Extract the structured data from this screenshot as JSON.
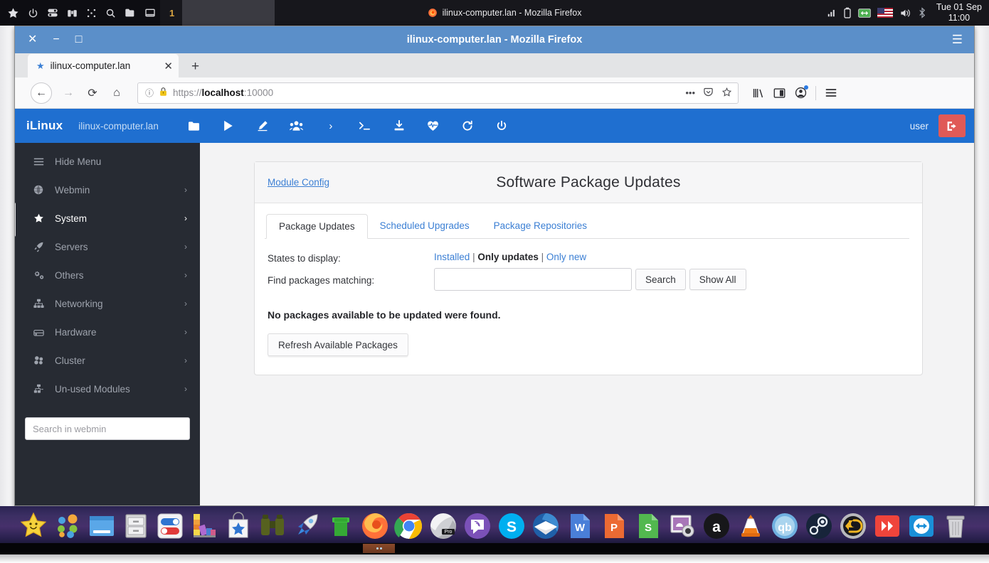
{
  "system_panel": {
    "left_icons": [
      {
        "name": "star-icon",
        "glyph": "★"
      },
      {
        "name": "power-icon",
        "glyph": "⏻"
      },
      {
        "name": "toggles-icon",
        "glyph": "⚏"
      },
      {
        "name": "binoculars-icon",
        "glyph": "🔭"
      },
      {
        "name": "grid-dots-icon",
        "glyph": "⠿"
      },
      {
        "name": "search-icon",
        "glyph": "🔍"
      },
      {
        "name": "folder-icon",
        "glyph": "📁"
      },
      {
        "name": "window-icon",
        "glyph": "🗖"
      }
    ],
    "desktop_number": "1",
    "window_title": "ilinux-computer.lan - Mozilla Firefox",
    "tray_icons": [
      "signal-icon",
      "battery-icon",
      "network-icon",
      "flag-us-icon",
      "volume-icon",
      "bluetooth-icon"
    ],
    "clock_date": "Tue 01 Sep",
    "clock_time": "11:00"
  },
  "browser": {
    "title": "ilinux-computer.lan - Mozilla Firefox",
    "window_buttons": {
      "close": "✕",
      "minimize": "−",
      "maximize": "□"
    },
    "hamburger": "☰",
    "tab": {
      "label": "ilinux-computer.lan",
      "close": "✕"
    },
    "new_tab": "+",
    "nav": {
      "back": "←",
      "forward": "→",
      "reload": "⟳",
      "home": "⌂"
    },
    "url": {
      "scheme": "https://",
      "host": "localhost",
      "port": ":10000",
      "full": "https://localhost:10000"
    },
    "url_actions": {
      "ellipsis": "•••",
      "pocket": "pocket-icon",
      "bookmark": "star-icon"
    },
    "toolbar_icons": [
      "library-icon",
      "sidebar-icon",
      "account-icon",
      "menu-icon"
    ]
  },
  "webmin": {
    "brand": "iLinux",
    "hostname": "ilinux-computer.lan",
    "nav_icons": [
      {
        "name": "folder-icon"
      },
      {
        "name": "play-icon"
      },
      {
        "name": "pencil-icon"
      },
      {
        "name": "users-icon"
      },
      {
        "name": "chevron-right-icon"
      },
      {
        "name": "terminal-icon"
      },
      {
        "name": "download-icon"
      },
      {
        "name": "heartbeat-icon"
      },
      {
        "name": "refresh-icon"
      },
      {
        "name": "power-icon"
      }
    ],
    "user": "user",
    "logout_label": "logout-icon",
    "sidebar": {
      "hide_menu": "Hide Menu",
      "items": [
        {
          "label": "Webmin",
          "icon": "globe-icon",
          "active": false
        },
        {
          "label": "System",
          "icon": "star-icon",
          "active": true
        },
        {
          "label": "Servers",
          "icon": "rocket-icon",
          "active": false
        },
        {
          "label": "Others",
          "icon": "gears-icon",
          "active": false
        },
        {
          "label": "Networking",
          "icon": "sitemap-icon",
          "active": false
        },
        {
          "label": "Hardware",
          "icon": "drive-icon",
          "active": false
        },
        {
          "label": "Cluster",
          "icon": "cubes-icon",
          "active": false
        },
        {
          "label": "Un-used Modules",
          "icon": "plug-icon",
          "active": false
        }
      ],
      "chevron": "›",
      "search_placeholder": "Search in webmin"
    },
    "panel": {
      "module_config": "Module Config",
      "title": "Software Package Updates",
      "tabs": [
        {
          "label": "Package Updates",
          "active": true
        },
        {
          "label": "Scheduled Upgrades",
          "active": false
        },
        {
          "label": "Package Repositories",
          "active": false
        }
      ],
      "states_label": "States to display:",
      "states": {
        "installed": "Installed",
        "sep1": "|",
        "only_updates": "Only updates",
        "sep2": "|",
        "only_new": "Only new"
      },
      "find_label": "Find packages matching:",
      "find_value": "",
      "find_placeholder": "",
      "search_button": "Search",
      "show_all_button": "Show All",
      "no_packages_message": "No packages available to be updated were found.",
      "refresh_button": "Refresh Available Packages"
    }
  },
  "dock": {
    "items": [
      {
        "name": "dock-smiley-star",
        "label": "Smiley Star"
      },
      {
        "name": "dock-app-dots",
        "label": "Applications"
      },
      {
        "name": "dock-window-manager",
        "label": "Window Manager"
      },
      {
        "name": "dock-file-cabinet",
        "label": "File Cabinet"
      },
      {
        "name": "dock-settings-toggles",
        "label": "Settings"
      },
      {
        "name": "dock-color-palette",
        "label": "Color Palette"
      },
      {
        "name": "dock-software-store",
        "label": "Software Store"
      },
      {
        "name": "dock-binoculars",
        "label": "Search"
      },
      {
        "name": "dock-rocket",
        "label": "Launcher"
      },
      {
        "name": "dock-pipe",
        "label": "Pipe"
      },
      {
        "name": "dock-firefox",
        "label": "Firefox"
      },
      {
        "name": "dock-chrome",
        "label": "Google Chrome"
      },
      {
        "name": "dock-opera-pro",
        "label": "Pro Browser"
      },
      {
        "name": "dock-viber",
        "label": "Viber"
      },
      {
        "name": "dock-skype",
        "label": "Skype"
      },
      {
        "name": "dock-thunderbird",
        "label": "Thunderbird"
      },
      {
        "name": "dock-writer",
        "label": "Writer"
      },
      {
        "name": "dock-impress",
        "label": "Impress"
      },
      {
        "name": "dock-calc",
        "label": "Calc"
      },
      {
        "name": "dock-screenshot",
        "label": "Screenshot Tool"
      },
      {
        "name": "dock-amazon",
        "label": "Amazon"
      },
      {
        "name": "dock-vlc",
        "label": "VLC"
      },
      {
        "name": "dock-qbittorrent",
        "label": "qBittorrent"
      },
      {
        "name": "dock-steam",
        "label": "Steam"
      },
      {
        "name": "dock-restore",
        "label": "Restore"
      },
      {
        "name": "dock-anydesk",
        "label": "AnyDesk"
      },
      {
        "name": "dock-teamviewer",
        "label": "TeamViewer"
      },
      {
        "name": "dock-trash",
        "label": "Trash"
      }
    ]
  },
  "colors": {
    "webmin_blue": "#1f6fd0",
    "sidebar_dark": "#272b33",
    "link_blue": "#3b7fd4",
    "logout_red": "#e05a57",
    "titlebar_blue": "#5b8fc9"
  }
}
